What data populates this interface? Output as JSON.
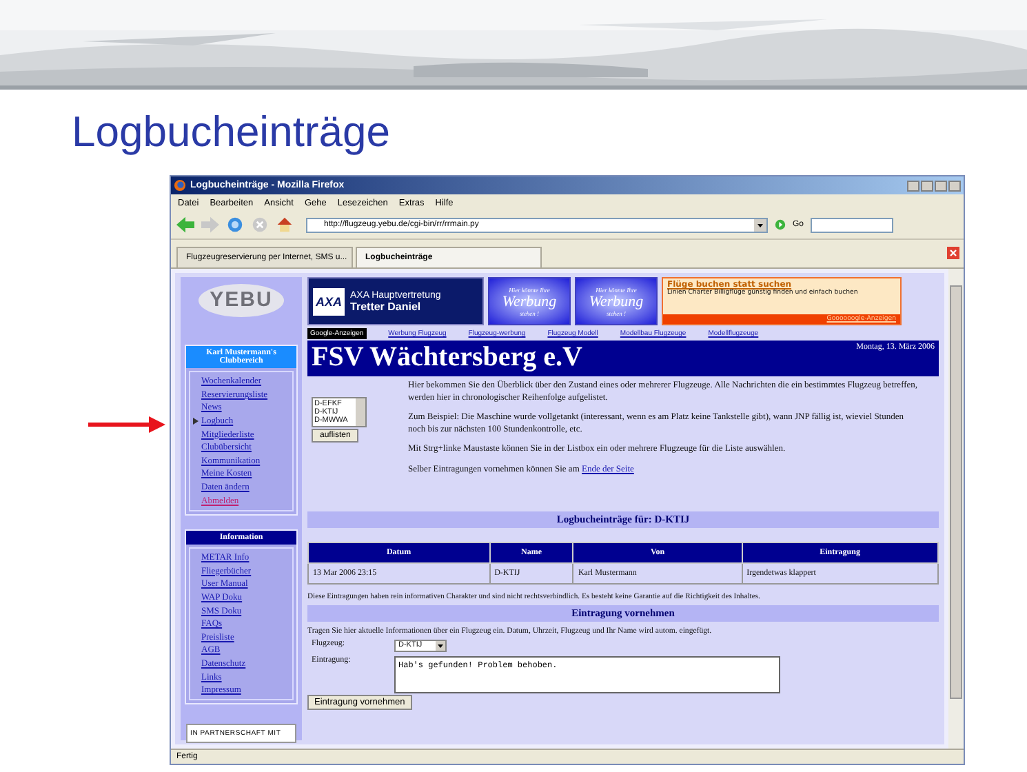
{
  "slide_title": "Logbucheinträge",
  "window": {
    "title": "Logbucheinträge - Mozilla Firefox"
  },
  "menu": [
    "Datei",
    "Bearbeiten",
    "Ansicht",
    "Gehe",
    "Lesezeichen",
    "Extras",
    "Hilfe"
  ],
  "address": {
    "value": "http://flugzeug.yebu.de/cgi-bin/rr/rrmain.py",
    "go": "Go"
  },
  "tabs": [
    {
      "label": "Flugzeugreservierung per Internet, SMS u...",
      "selected": false
    },
    {
      "label": "Logbucheinträge",
      "selected": true
    }
  ],
  "logo": "YEBU",
  "club_box": {
    "title": "Karl Mustermann's Clubbereich",
    "items": [
      {
        "label": "Wochenkalender",
        "selected": false,
        "kind": "link"
      },
      {
        "label": "Reservierungsliste",
        "selected": false,
        "kind": "link"
      },
      {
        "label": "News",
        "selected": false,
        "kind": "link"
      },
      {
        "label": "Logbuch",
        "selected": true,
        "kind": "link"
      },
      {
        "label": "Mitgliederliste",
        "selected": false,
        "kind": "link"
      },
      {
        "label": "Clubübersicht",
        "selected": false,
        "kind": "link"
      },
      {
        "label": "Kommunikation",
        "selected": false,
        "kind": "link"
      },
      {
        "label": "Meine Kosten",
        "selected": false,
        "kind": "link"
      },
      {
        "label": "Daten ändern",
        "selected": false,
        "kind": "link"
      },
      {
        "label": "Abmelden",
        "selected": false,
        "kind": "logout"
      }
    ]
  },
  "info_box": {
    "title": "Information",
    "items": [
      "METAR Info",
      "Fliegerbücher",
      "User Manual",
      "WAP Doku",
      "SMS Doku",
      "FAQs",
      "Preisliste",
      "AGB",
      "Datenschutz",
      "Links",
      "Impressum"
    ]
  },
  "partner": "IN PARTNERSCHAFT MIT",
  "banners": {
    "axa": {
      "logo": "AXA",
      "line_1": "AXA Hauptvertretung",
      "line_2": "Tretter Daniel"
    },
    "ads": [
      {
        "top": "Hier könnte Ihre",
        "main": "Werbung",
        "bottom": "stehen !"
      },
      {
        "top": "Hier könnte Ihre",
        "main": "Werbung",
        "bottom": "stehen !"
      }
    ],
    "google": {
      "title": "Flüge buchen statt suchen",
      "text": "Linien Charter Billigflüge günstig finden und einfach buchen",
      "footer": "Goooooogle-Anzeigen"
    }
  },
  "ad_links": {
    "label": "Google-Anzeigen",
    "links": [
      "Werbung Flugzeug",
      "Flugzeug-werbung",
      "Flugzeug Modell",
      "Modellbau Flugzeuge",
      "Modellflugzeuge"
    ]
  },
  "header": {
    "title": "FSV Wächtersberg e.V",
    "date": "Montag, 13. März 2006"
  },
  "listbox": {
    "items": [
      "D-EFKF",
      "D-KTIJ",
      "D-MWWA"
    ],
    "button": "auflisten"
  },
  "intro": [
    "Hier bekommen Sie den Überblick über den Zustand eines oder mehrerer Flugzeuge. Alle Nachrichten die ein bestimmtes Flugzeug betreffen, werden hier in chronologischer Reihenfolge aufgelistet.",
    "Zum Beispiel: Die Maschine wurde vollgetankt (interessant, wenn es am Platz keine Tankstelle gibt), wann JNP fällig ist, wieviel Stunden noch bis zur nächsten 100 Stundenkontrolle, etc.",
    "Mit Strg+linke Maustaste können Sie in der Listbox ein oder mehrere Flugzeuge für die Liste auswählen."
  ],
  "self_entry": {
    "text": "Selber Eintragungen vornehmen können Sie am",
    "link": "Ende der Seite"
  },
  "log_heading": "Logbucheinträge für: D-KTIJ",
  "table": {
    "columns": [
      "Datum",
      "Name",
      "Von",
      "Eintragung"
    ],
    "rows": [
      [
        "13 Mar 2006 23:15",
        "D-KTIJ",
        "Karl Mustermann",
        "Irgendetwas klappert"
      ]
    ]
  },
  "disclaimer": "Diese Eintragungen haben rein informativen Charakter und sind nicht rechtsverbindlich. Es besteht keine Garantie auf die Richtigkeit des Inhaltes.",
  "form": {
    "heading": "Eintragung vornehmen",
    "hint": "Tragen Sie hier aktuelle Informationen über ein Flugzeug ein. Datum, Uhrzeit, Flugzeug und Ihr Name wird autom. eingefügt.",
    "plane_label": "Flugzeug:",
    "plane_value": "D-KTIJ",
    "entry_label": "Eintragung:",
    "entry_value": "Hab's gefunden! Problem behoben.",
    "button": "Eintragung vornehmen"
  },
  "status_bar": "Fertig"
}
